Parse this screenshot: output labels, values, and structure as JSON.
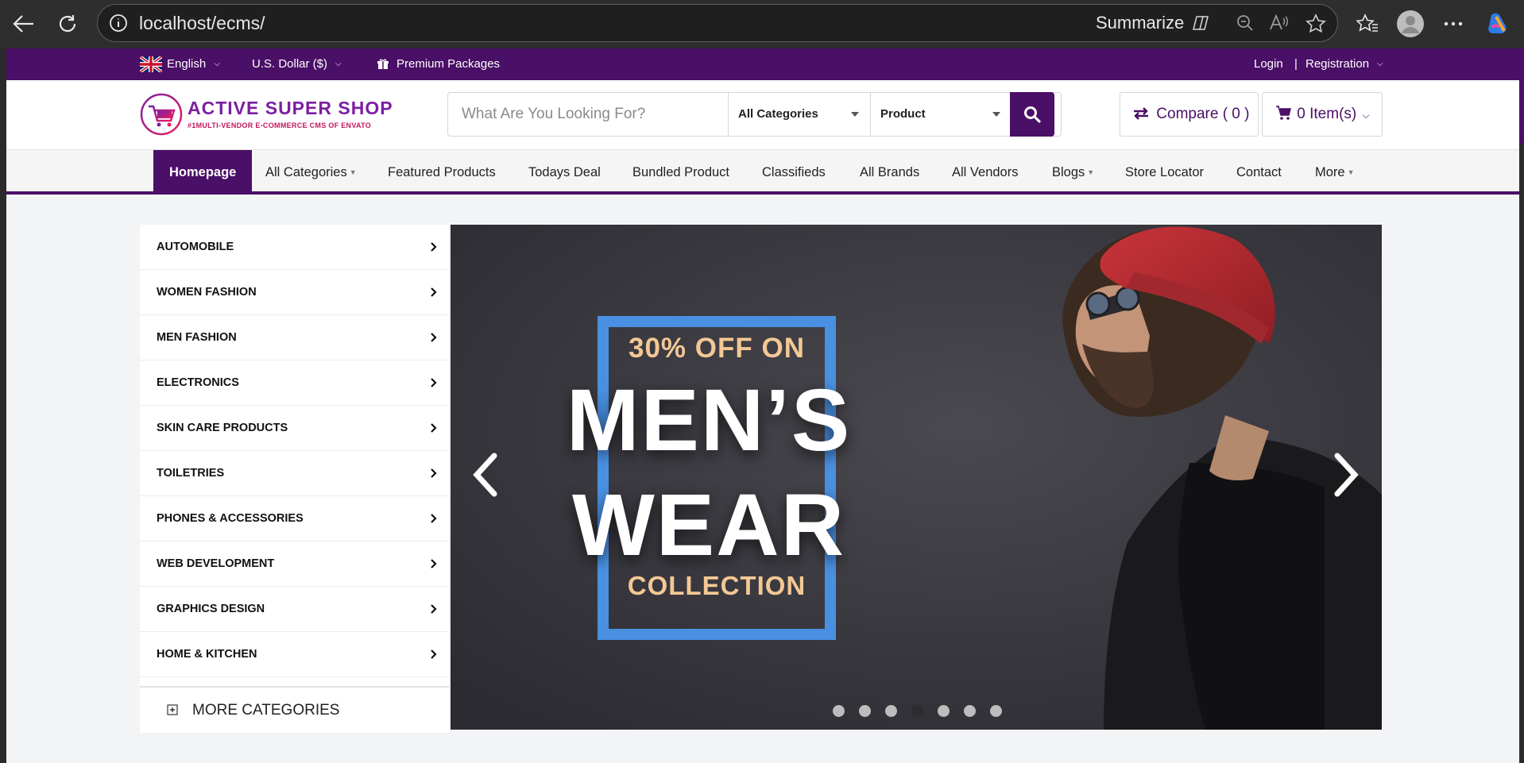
{
  "browser": {
    "url": "localhost/ecms/",
    "summarize_label": "Summarize"
  },
  "topbar": {
    "language": "English",
    "currency": "U.S. Dollar ($)",
    "premium": "Premium Packages",
    "login": "Login",
    "separator": "|",
    "registration": "Registration"
  },
  "header": {
    "logo_title": "ACTIVE SUPER SHOP",
    "logo_tagline": "#1MULTI-VENDOR E-COMMERCE CMS OF ENVATO",
    "search_placeholder": "What Are You Looking For?",
    "category_select": "All Categories",
    "type_select": "Product",
    "compare_label": "Compare ( 0 )",
    "cart_label": "0 Item(s)"
  },
  "nav": {
    "items": [
      {
        "label": "Homepage"
      },
      {
        "label": "All Categories"
      },
      {
        "label": "Featured Products"
      },
      {
        "label": "Todays Deal"
      },
      {
        "label": "Bundled Product"
      },
      {
        "label": "Classifieds"
      },
      {
        "label": "All Brands"
      },
      {
        "label": "All Vendors"
      },
      {
        "label": "Blogs"
      },
      {
        "label": "Store Locator"
      },
      {
        "label": "Contact"
      },
      {
        "label": "More"
      }
    ]
  },
  "categories": {
    "items": [
      {
        "label": "AUTOMOBILE"
      },
      {
        "label": "WOMEN FASHION"
      },
      {
        "label": "MEN FASHION"
      },
      {
        "label": "ELECTRONICS"
      },
      {
        "label": "SKIN CARE PRODUCTS"
      },
      {
        "label": "TOILETRIES"
      },
      {
        "label": "PHONES & ACCESSORIES"
      },
      {
        "label": "WEB DEVELOPMENT"
      },
      {
        "label": "GRAPHICS DESIGN"
      },
      {
        "label": "HOME & KITCHEN"
      }
    ],
    "more_label": "MORE CATEGORIES"
  },
  "slider": {
    "line1": "30% OFF ON",
    "line2": "MEN’S",
    "line3": "WEAR",
    "line4": "COLLECTION",
    "active_slide": 4,
    "slide_count": 7
  },
  "colors": {
    "brand": "#4a0f66",
    "frame": "#4a90e2",
    "promo_accent": "#f3c894"
  }
}
